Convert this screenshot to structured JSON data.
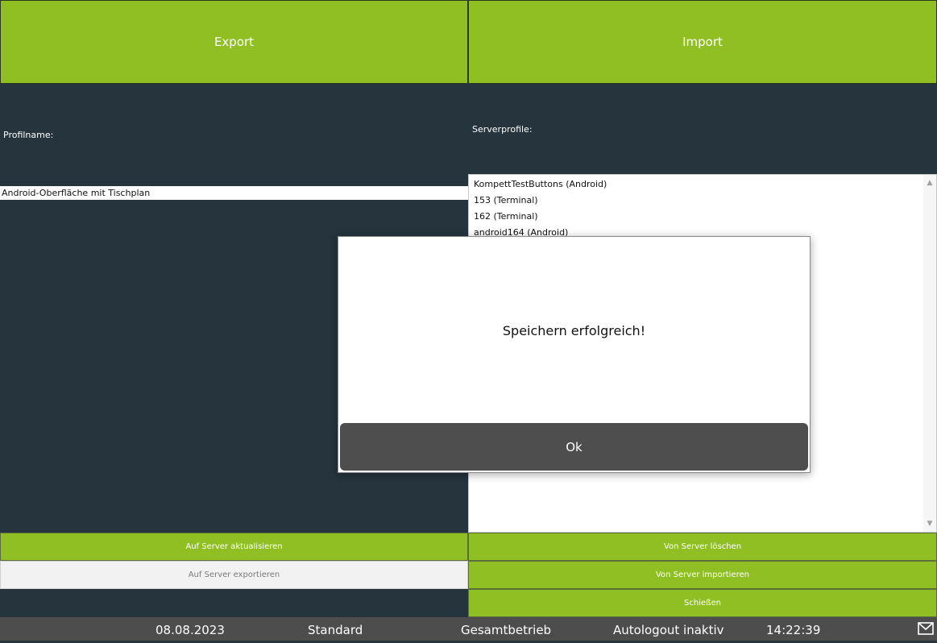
{
  "header": {
    "export_label": "Export",
    "import_label": "Import"
  },
  "export_panel": {
    "profile_label": "Profilname:",
    "profile_value": "Android-Oberfläche mit Tischplan",
    "update_button": "Auf Server aktualisieren",
    "export_button": "Auf Server exportieren"
  },
  "import_panel": {
    "server_profiles_label": "Serverprofile:",
    "server_profiles": [
      "KompettTestButtons (Android)",
      "153 (Terminal)",
      "162 (Terminal)",
      "android164 (Android)"
    ],
    "delete_button": "Von Server löschen",
    "import_button": "Von Server importieren",
    "close_button": "Schießen"
  },
  "dialog": {
    "message": "Speichern erfolgreich!",
    "ok_label": "Ok"
  },
  "status_bar": {
    "date": "08.08.2023",
    "mode": "Standard",
    "operation": "Gesamtbetrieb",
    "autologout": "Autologout inaktiv",
    "time": "14:22:39",
    "mail_icon": "mail-icon"
  },
  "colors": {
    "accent_green": "#8fbf22",
    "background_dark": "#25343d",
    "status_bar": "#4d4d4d",
    "dialog_button": "#4e4e4e"
  }
}
